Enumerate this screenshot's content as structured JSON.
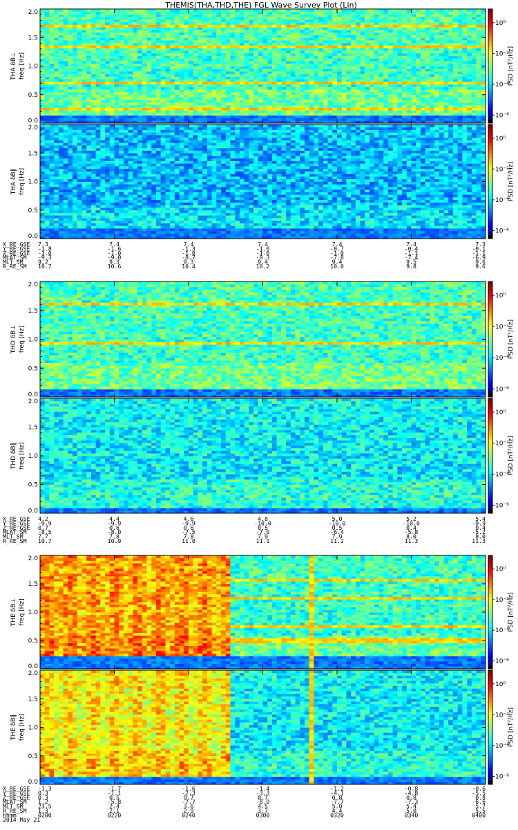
{
  "title": "THEMIS(THA,THD,THE) FGL Wave Survey Plot (Lin)",
  "colorbar_label": "PSD [nT²/Hz]",
  "colorbar_ticks_top": [
    "10⁰",
    "10⁻²",
    "10⁻⁴",
    "10⁻⁶"
  ],
  "colorbar_ticks_bottom": [
    "10⁰",
    "10⁻²",
    "10⁻⁴",
    "10⁻⁶"
  ],
  "chart_data": [
    {
      "type": "heatmap",
      "probe": "THA",
      "panels": [
        {
          "label": "THA δB⊥",
          "ylabel": "freq [Hz]",
          "yticks": [
            "0.0",
            "0.5",
            "1.0",
            "1.5",
            "2.0"
          ],
          "ylim": [
            0,
            2.0
          ],
          "lines": [
            0.27,
            0.7,
            1.35,
            1.7
          ],
          "background": "cyan-green",
          "low_band": 0.12
        },
        {
          "label": "THA δB∥",
          "ylabel": "freq [Hz]",
          "yticks": [
            "0.0",
            "0.5",
            "1.0",
            "1.5",
            "2.0"
          ],
          "ylim": [
            0,
            2.0
          ],
          "lines": [],
          "background": "blue-cyan",
          "low_band": 0.18
        }
      ],
      "ephemeris": [
        {
          "name": "X_RE_GSE",
          "values": [
            "7.3",
            "7.4",
            "7.4",
            "7.4",
            "7.4",
            "7.4",
            "7.3"
          ]
        },
        {
          "name": "Y_RE_GSE",
          "values": [
            "-1.8",
            "-1.6",
            "-1.3",
            "-1.0",
            "-0.7",
            "-0.4",
            "-0.1"
          ]
        },
        {
          "name": "Z_RE_GSE",
          "values": [
            "-1.0",
            "-1.0",
            "-1.0",
            "-1.0",
            "-1.0",
            "-1.1",
            "-1.1"
          ]
        },
        {
          "name": "MLAT_SM",
          "values": [
            "-9.3",
            "-9.0",
            "-8.7",
            "-8.3",
            "-7.8",
            "-7.4",
            "-6.9"
          ]
        },
        {
          "name": "MLT_SM",
          "values": [
            "9.2",
            "9.3",
            "9.3",
            "9.4",
            "9.4",
            "9.5",
            "9.6"
          ]
        },
        {
          "name": "R_RE_SM",
          "values": [
            "10.7",
            "10.6",
            "10.4",
            "10.2",
            "10.0",
            "9.8",
            "9.6"
          ]
        }
      ]
    },
    {
      "type": "heatmap",
      "probe": "THD",
      "panels": [
        {
          "label": "THD δB⊥",
          "ylabel": "freq [Hz]",
          "yticks": [
            "0.0",
            "0.5",
            "1.0",
            "1.5",
            "2.0"
          ],
          "ylim": [
            0,
            2.0
          ],
          "lines": [
            0.95,
            1.6
          ],
          "background": "cyan-green",
          "low_band": 0.14
        },
        {
          "label": "THD δB∥",
          "ylabel": "freq [Hz]",
          "yticks": [
            "0.0",
            "0.5",
            "1.0",
            "1.5",
            "2.0"
          ],
          "ylim": [
            0,
            2.0
          ],
          "lines": [],
          "background": "cyan",
          "low_band": 0.1
        }
      ],
      "ephemeris": [
        {
          "name": "X_RE_GSE",
          "values": [
            "4.2",
            "4.4",
            "4.6",
            "4.8",
            "5.0",
            "5.2",
            "5.4"
          ]
        },
        {
          "name": "Y_RE_GSE",
          "values": [
            "-9.9",
            "-9.9",
            "-9.9",
            "-10.0",
            "-10.0",
            "-10.0",
            "-9.9"
          ]
        },
        {
          "name": "Z_RE_GSE",
          "values": [
            "0.7",
            "0.6",
            "0.6",
            "0.5",
            "0.5",
            "0.4",
            "0.4"
          ]
        },
        {
          "name": "MLAT_SM",
          "values": [
            "-8.5",
            "-8.0",
            "-7.5",
            "-7.0",
            "-6.4",
            "-5.8",
            "-5.2"
          ]
        },
        {
          "name": "MLT_SM",
          "values": [
            "7.7",
            "7.8",
            "7.8",
            "7.9",
            "7.9",
            "8.0",
            "8.0"
          ]
        },
        {
          "name": "R_RE_SM",
          "values": [
            "10.7",
            "10.9",
            "11.0",
            "11.1",
            "11.2",
            "11.3",
            "11.3"
          ]
        }
      ]
    },
    {
      "type": "heatmap",
      "probe": "THE",
      "panels": [
        {
          "label": "THE δB⊥",
          "ylabel": "freq [Hz]",
          "yticks": [
            "0.0",
            "0.5",
            "1.0",
            "1.5",
            "2.0"
          ],
          "ylim": [
            0,
            2.0
          ],
          "lines": [
            0.5,
            0.75,
            1.25,
            1.55
          ],
          "background": "yellow-orange",
          "low_band": 0.22
        },
        {
          "label": "THE δB∥",
          "ylabel": "freq [Hz]",
          "yticks": [
            "0.0",
            "0.5",
            "1.0",
            "1.5",
            "2.0"
          ],
          "ylim": [
            0,
            2.0
          ],
          "lines": [],
          "background": "yellow",
          "low_band": 0.15
        }
      ],
      "ephemeris": [
        {
          "name": "X_RE_GSE",
          "values": [
            "-1.3",
            "-1.7",
            "-1.6",
            "-1.4",
            "-1.2",
            "-0.8",
            "-0.6"
          ]
        },
        {
          "name": "Y_RE_GSE",
          "values": [
            "0.3",
            "-1.1",
            "-2.3",
            "-3.3",
            "-4.1",
            "-4.8",
            "-5.5"
          ]
        },
        {
          "name": "Z_RE_GSE",
          "values": [
            "0.3",
            "0.5",
            "0.7",
            "0.7",
            "0.8",
            "0.8",
            "0.8"
          ]
        },
        {
          "name": "MLAT_SM",
          "values": [
            "1.2",
            "-5.8",
            "-7.7",
            "-8.0",
            "-7.7",
            "-7.3",
            "-6.6"
          ]
        },
        {
          "name": "MLT_SM",
          "values": [
            "23.5",
            "2.4",
            "3.6",
            "4.5",
            "5.0",
            "5.4",
            "5.7"
          ]
        },
        {
          "name": "R_RE_SM",
          "values": [
            "1.3",
            "2.1",
            "2.9",
            "3.7",
            "4.4",
            "5.0",
            "5.5"
          ]
        },
        {
          "name": "hhmm",
          "values": [
            "0200",
            "0220",
            "0240",
            "0300",
            "0320",
            "0340",
            "0400"
          ]
        }
      ],
      "date": "2014 May 21"
    }
  ]
}
